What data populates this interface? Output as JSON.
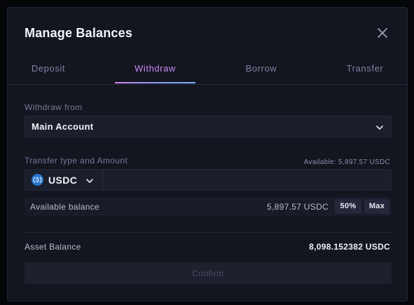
{
  "modal": {
    "title": "Manage Balances",
    "close_icon": "close-icon"
  },
  "tabs": [
    {
      "label": "Deposit",
      "active": false
    },
    {
      "label": "Withdraw",
      "active": true
    },
    {
      "label": "Borrow",
      "active": false
    },
    {
      "label": "Transfer",
      "active": false
    }
  ],
  "withdraw_from": {
    "label": "Withdraw from",
    "selected": "Main Account",
    "icon": "chevron-down-icon"
  },
  "transfer": {
    "label": "Transfer type and Amount",
    "available": "Available: 5,897.57 USDC",
    "token": "USDC",
    "token_icon": "usdc-icon",
    "amount_value": "",
    "amount_placeholder": ""
  },
  "balance": {
    "label": "Available balance",
    "value": "5,897.57 USDC",
    "half_label": "50%",
    "max_label": "Max"
  },
  "asset": {
    "label": "Asset Balance",
    "value": "8,098.152382 USDC"
  },
  "confirm_label": "Confirm",
  "colors": {
    "background": "#13151f",
    "accent_gradient_start": "#d786f2",
    "accent_gradient_end": "#78b4f8",
    "active_tab": "#c58cf5",
    "usdc": "#2775ca"
  }
}
